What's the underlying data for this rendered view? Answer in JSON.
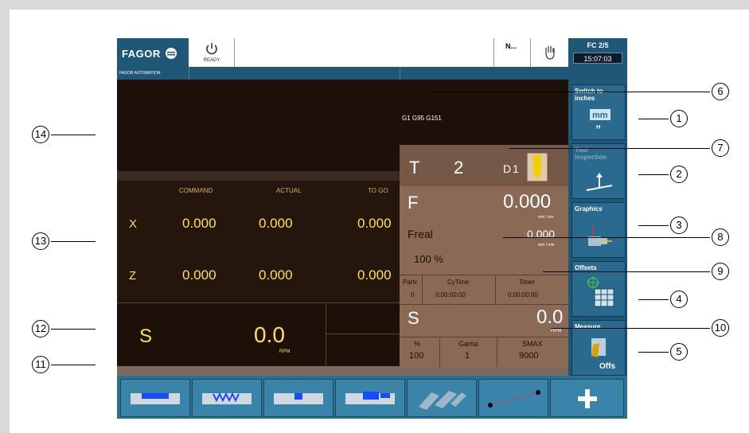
{
  "header": {
    "brand": "FAGOR",
    "brand_sub": "FAGOR AUTOMATION",
    "status": "READY",
    "mode": "N...",
    "fc": "FC 2/5",
    "time": "15:07:03"
  },
  "softkeys": [
    {
      "l1": "Switch to",
      "l2": "inches",
      "icon": "mm-inch-icon",
      "dim": false
    },
    {
      "l1": "Tool",
      "l2": "inspection",
      "icon": "tool-inspection-icon",
      "dim": true
    },
    {
      "l1": "Graphics",
      "l2": "",
      "icon": "graphics-icon",
      "dim": false
    },
    {
      "l1": "Offsets",
      "l2": "",
      "icon": "offsets-icon",
      "dim": false
    },
    {
      "l1": "Measure",
      "l2": "",
      "icon": "measure-icon",
      "dim": false
    }
  ],
  "measure_offs": "Offs",
  "gcodes": "G1 G95 G151",
  "tool": {
    "t_label": "T",
    "t_value": "2",
    "d_label": "D",
    "d_value": "1"
  },
  "feed": {
    "label": "F",
    "value": "0.000",
    "unit": "mm / rev",
    "freal_label": "Freal",
    "freal_value": "0.000",
    "freal_unit": "mm / min",
    "override": "100 %"
  },
  "counters": {
    "parts_label": "Partc",
    "parts_value": "0",
    "cytime_label": "CyTime",
    "cytime_value": "0:00:00:00",
    "timer_label": "Timer",
    "timer_value": "0:00:00:00"
  },
  "spindle_right": {
    "label": "S",
    "value": "0.0",
    "unit": "RPM",
    "pct_label": "%",
    "pct_value": "100",
    "gama_label": "Gama",
    "gama_value": "1",
    "smax_label": "SMAX",
    "smax_value": "9000"
  },
  "axes": {
    "headers": [
      "COMMAND",
      "ACTUAL",
      "TO GO"
    ],
    "rows": [
      {
        "axis": "X",
        "command": "0.000",
        "actual": "0.000",
        "togo": "0.000"
      },
      {
        "axis": "Z",
        "command": "0.000",
        "actual": "0.000",
        "togo": "0.000"
      }
    ]
  },
  "spindle_left": {
    "label": "S",
    "value": "0.0",
    "unit": "RPM"
  },
  "bottom_icons": [
    "cycle-turning-icon",
    "cycle-threading-icon",
    "cycle-grooving-icon",
    "cycle-profile-icon",
    "cycle-drilling-icon",
    "cycle-positioning-icon",
    "more-plus-icon"
  ],
  "callouts": [
    "1",
    "2",
    "3",
    "4",
    "5",
    "6",
    "7",
    "8",
    "9",
    "10",
    "11",
    "12",
    "13",
    "14"
  ],
  "colors": {
    "panel_bg": "#1f5876",
    "yellow": "#ffe14a",
    "brown": "#8b6a55"
  }
}
